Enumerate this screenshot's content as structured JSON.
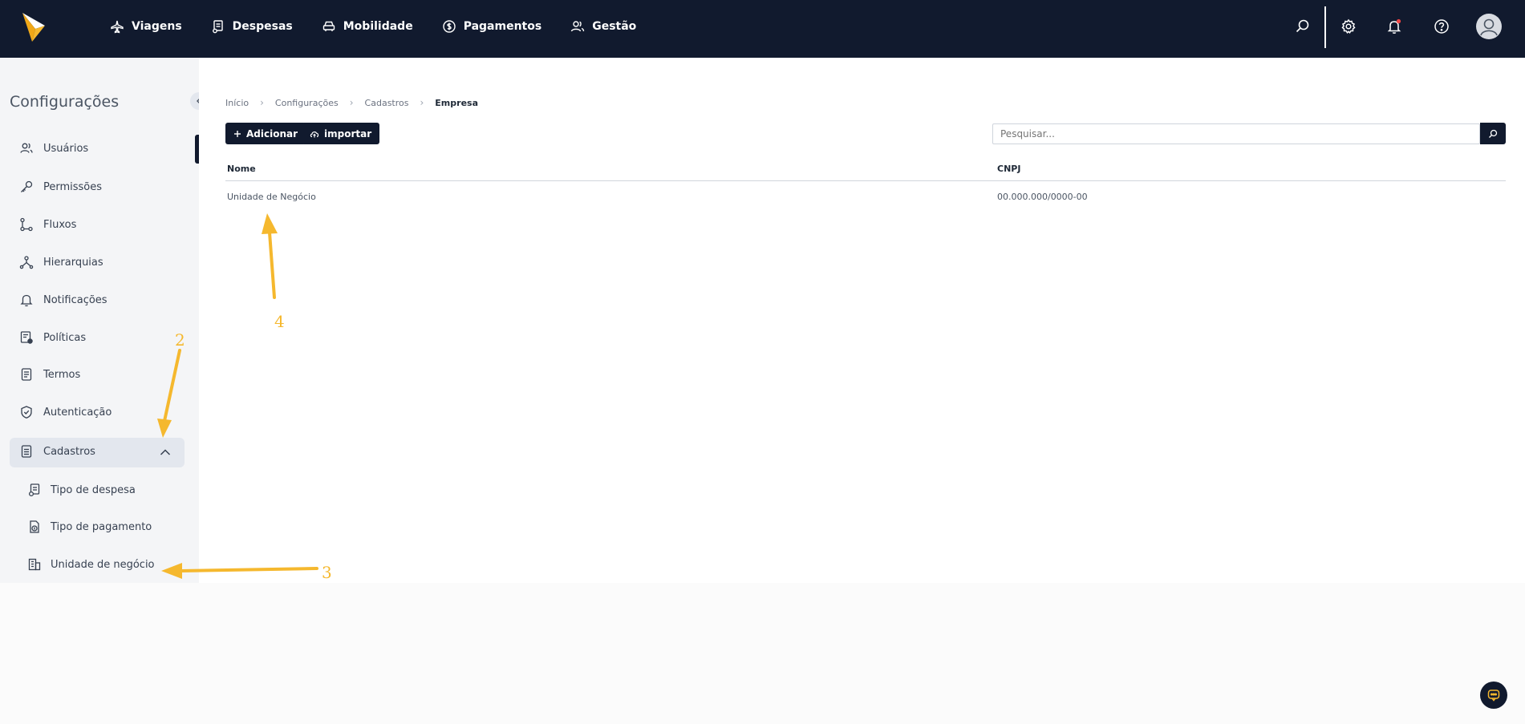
{
  "nav": {
    "items": [
      {
        "label": "Viagens",
        "icon": "airplane-icon"
      },
      {
        "label": "Despesas",
        "icon": "receipt-icon"
      },
      {
        "label": "Mobilidade",
        "icon": "car-icon"
      },
      {
        "label": "Pagamentos",
        "icon": "dollar-icon"
      },
      {
        "label": "Gestão",
        "icon": "users-icon"
      }
    ]
  },
  "sidebar": {
    "title": "Configurações",
    "items": [
      {
        "label": "Usuários",
        "icon": "users-icon"
      },
      {
        "label": "Permissões",
        "icon": "key-icon"
      },
      {
        "label": "Fluxos",
        "icon": "flow-icon"
      },
      {
        "label": "Hierarquias",
        "icon": "hierarchy-icon"
      },
      {
        "label": "Notificações",
        "icon": "bell-icon"
      },
      {
        "label": "Políticas",
        "icon": "policy-icon"
      },
      {
        "label": "Termos",
        "icon": "document-icon"
      },
      {
        "label": "Autenticação",
        "icon": "shield-check-icon"
      },
      {
        "label": "Cadastros",
        "icon": "file-list-icon",
        "expanded": true
      }
    ],
    "sub_items": [
      {
        "label": "Tipo de despesa",
        "icon": "receipt-icon"
      },
      {
        "label": "Tipo de pagamento",
        "icon": "payment-doc-icon"
      },
      {
        "label": "Unidade de negócio",
        "icon": "building-icon"
      }
    ]
  },
  "breadcrumb": [
    "Início",
    "Configurações",
    "Cadastros",
    "Empresa"
  ],
  "toolbar": {
    "add_label": "Adicionar",
    "import_label": "importar"
  },
  "search": {
    "placeholder": "Pesquisar..."
  },
  "table": {
    "columns": [
      "Nome",
      "CNPJ"
    ],
    "rows": [
      {
        "nome": "Unidade de Negócio",
        "cnpj": "00.000.000/0000-00"
      }
    ]
  },
  "annotations": [
    "2",
    "3",
    "4"
  ],
  "colors": {
    "topbar": "#111a2e",
    "accent": "#f5b82e",
    "sidebar_bg": "#f4f5f7",
    "notification_dot": "#ef4444"
  }
}
